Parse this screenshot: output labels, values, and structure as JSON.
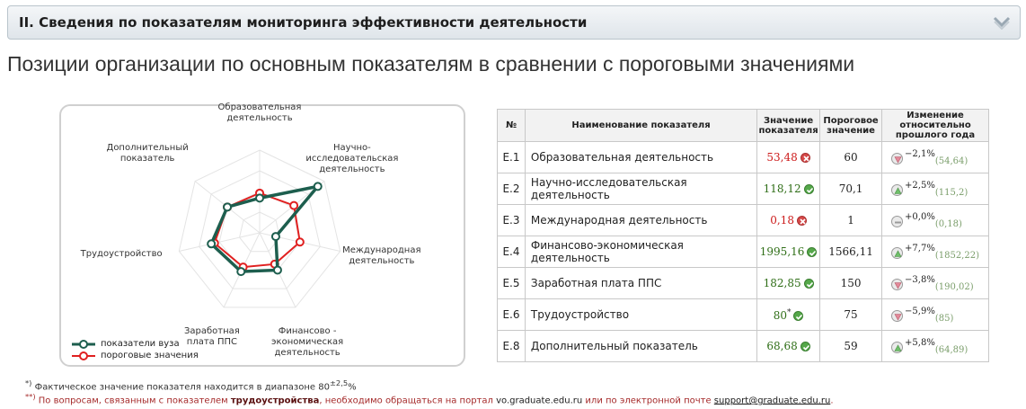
{
  "section": {
    "title": "II. Сведения по показателям мониторинга эффективности деятельности"
  },
  "page_title": "Позиции организации по основным показателям в сравнении с пороговыми значениями",
  "radar": {
    "axes": [
      {
        "label_lines": [
          "Образовательная",
          "деятельность"
        ]
      },
      {
        "label_lines": [
          "Научно-",
          "исследовательская",
          "деятельность"
        ]
      },
      {
        "label_lines": [
          "Международная",
          "деятельность"
        ]
      },
      {
        "label_lines": [
          "Финансово -",
          "экономическая",
          "деятельность"
        ]
      },
      {
        "label_lines": [
          "Заработная",
          "плата ППС"
        ]
      },
      {
        "label_lines": [
          "Трудоустройство"
        ]
      },
      {
        "label_lines": [
          "Дополнительный",
          "показатель"
        ]
      }
    ],
    "legend": {
      "series_label": "показатели вуза",
      "threshold_label": "пороговые значения"
    },
    "colors": {
      "series": "#1d5e4e",
      "threshold": "#e02020",
      "grid": "#e4e4e4"
    },
    "series_values": [
      0.42,
      0.9,
      0.2,
      0.5,
      0.52,
      0.6,
      0.5
    ],
    "threshold_values": [
      0.48,
      0.53,
      0.5,
      0.42,
      0.46,
      0.56,
      0.5
    ]
  },
  "table": {
    "headers": {
      "no": "№",
      "name": "Наименование показателя",
      "value_l1": "Значение",
      "value_l2": "показателя",
      "thr_l1": "Пороговое",
      "thr_l2": "значение",
      "chg_l1": "Изменение",
      "chg_l2": "относительно",
      "chg_l3": "прошлого года"
    },
    "rows": [
      {
        "code": "E.1",
        "name": "Образовательная деятельность",
        "value": "53,48",
        "status": "bad",
        "threshold": "60",
        "change": "−2,1%",
        "trend": "down",
        "prev": "(54,64)"
      },
      {
        "code": "E.2",
        "name": "Научно-исследовательская деятельность",
        "value": "118,12",
        "status": "good",
        "threshold": "70,1",
        "change": "+2,5%",
        "trend": "up",
        "prev": "(115,2)"
      },
      {
        "code": "E.3",
        "name": "Международная деятельность",
        "value": "0,18",
        "status": "bad",
        "threshold": "1",
        "change": "+0,0%",
        "trend": "flat",
        "prev": "(0,18)"
      },
      {
        "code": "E.4",
        "name": "Финансово-экономическая деятельность",
        "value": "1995,16",
        "status": "good",
        "threshold": "1566,11",
        "change": "+7,7%",
        "trend": "up",
        "prev": "(1852,22)"
      },
      {
        "code": "E.5",
        "name": "Заработная плата ППС",
        "value": "182,85",
        "status": "good",
        "threshold": "150",
        "change": "−3,8%",
        "trend": "down",
        "prev": "(190,02)"
      },
      {
        "code": "E.6",
        "name": "Трудоустройство",
        "value": "80",
        "value_mark": "*",
        "status": "good",
        "threshold": "75",
        "change": "−5,9%",
        "trend": "down",
        "prev": "(85)"
      },
      {
        "code": "E.8",
        "name": "Дополнительный показатель",
        "value": "68,68",
        "status": "good",
        "threshold": "59",
        "change": "+5,8%",
        "trend": "up",
        "prev": "(64,89)"
      }
    ]
  },
  "footnotes": {
    "fn1_mark": "*)",
    "fn1_text": " Фактическое значение показателя находится в диапазоне 80",
    "fn1_sup": "±2,5",
    "fn1_tail": "%",
    "fn2_mark": "**)",
    "fn2_text1": " По вопросам, связанным с показателем ",
    "fn2_bold": "трудоустройства",
    "fn2_text2": ", необходимо обращаться на портал ",
    "fn2_link1": "vo.graduate.edu.ru",
    "fn2_text3": " или по электронной почте ",
    "fn2_link2": "support@graduate.edu.ru",
    "fn2_end": "."
  }
}
